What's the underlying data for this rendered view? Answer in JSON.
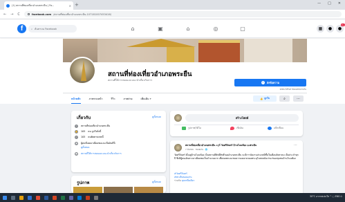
{
  "browser": {
    "tab_title": "(1) สถานที่ท่องเที่ยวอำเภอพระยืน | Fa...",
    "tab_close": "×",
    "new_tab": "+",
    "window_controls": [
      "—",
      "□",
      "✕"
    ],
    "nav": {
      "back": "←",
      "forward": "→",
      "reload": "C"
    },
    "url_host": "facebook.com",
    "url_path": "/สถานที่ท่องเที่ยวอำเภอพระยืน-107181007453416/"
  },
  "fb_header": {
    "logo": "f",
    "search_placeholder": "ค้นหาบน Facebook",
    "nav_icons": [
      "home-icon",
      "video-icon",
      "marketplace-icon",
      "groups-icon",
      "gaming-icon"
    ],
    "right_icons": [
      "menu-grid-icon",
      "messenger-icon",
      "bell-icon"
    ],
    "notification_count": "9+"
  },
  "page": {
    "name": "สถานที่ท่องเที่ยวอำเภอพระยืน",
    "category": "สถานที่ให้การสอนและแนะนำเกี่ยวกับการ",
    "send_message": "ส่งข้อความ",
    "reply_time": "ปกติจะได้รับการตอบกลับภายใน",
    "tabs": [
      "หน้าหลัก",
      "ภาพรวมหน้า",
      "รีวิว",
      "ภาพถ่าย",
      "เพิ่มเติม ▾"
    ],
    "like_button": "ถูกใจ",
    "search_icon": "⌕",
    "more_icon": "···"
  },
  "about": {
    "title": "เกี่ยวกับ",
    "see_all": "ดูทั้งหมด",
    "rows": [
      {
        "icon": "info-icon",
        "text": "สถานที่ท่องเที่ยวอำเภอพระยืน"
      },
      {
        "icon": "like-icon",
        "text": "คน ถูกใจสิ่งนี้",
        "count": "105"
      },
      {
        "icon": "follow-icon",
        "text": "คนติดตามเพจนี้",
        "count": "105"
      },
      {
        "icon": "checkin-icon",
        "text": "ผู้คนที่เคยมาเยี่ยมชมและเช็คอินที่นี่"
      },
      {
        "icon": "web-icon",
        "text": "สถานที่ให้การสอนและแนะนำเกี่ยวกับการ"
      }
    ],
    "row_link": "ดูทั้งหมด"
  },
  "photos": {
    "title": "รูปภาพ",
    "see_all": "ดูทั้งหมด"
  },
  "composer": {
    "placeholder": "สร้างโพสต์",
    "actions": [
      {
        "label": "รูปภาพ/วิดีโอ",
        "color": "#45bd62"
      },
      {
        "label": "เช็คอิน",
        "color": "#f3425f"
      },
      {
        "label": "แท็กเพื่อน",
        "color": "#1877f2"
      }
    ]
  },
  "post": {
    "author": "สถานที่ท่องเที่ยวอำเภอพระยืน",
    "author_suffix": "อยู่ที่",
    "location": "วัดศรีจันทร์ บ้านโนนฆ้อง อ.พระยืน",
    "meta": "7 มีนาคม · ขอนแก่น · 🌐",
    "more": "···",
    "body": "วัดศรีจันทร์ ตั้งอยู่บ้านโนนฆ้อง เป็นสถานที่ศักดิ์สิทธิ์ของอำเภอพระยืน จะมีการจัดงานประเพณีขึ้นในเดือนสิงหาคม เป็นประจำทุกปี ซึ่งมีผู้คนเดินทางมาเยี่ยมชมเป็นจำนวนมาก เพื่อขอพรและชมความงดงามของพระอุโบสถหลังเก่าแก่ของชุมชนบ้านโนนฆ้อง",
    "tag1": "#วัดศรีจันทร์",
    "tag2": "#พระยืนขอนแก่น",
    "tag3_prefix": "ร่วมกับ",
    "tag3_link": "คุณหนึ่งเดียว"
  },
  "taskbar": {
    "tray_text": "30°C อากาศแจ่มใส  ^  ▢  ENG  ⏻"
  },
  "colors": {
    "brand": "#1877f2",
    "page_bg": "#f0f2f5",
    "taskbar": "#1f2a36"
  }
}
